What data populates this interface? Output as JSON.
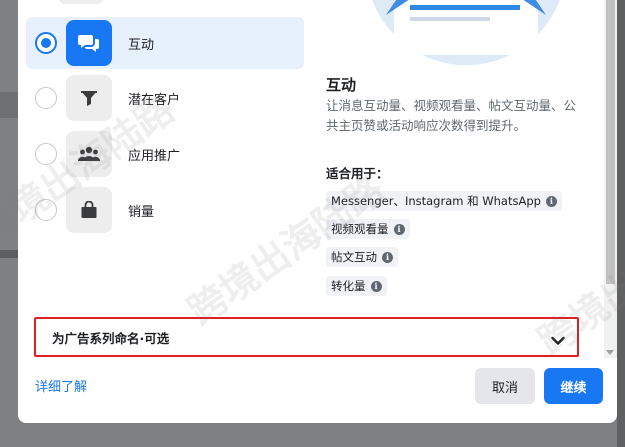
{
  "objectives": [
    {
      "label": "互动",
      "icon": "chat-bubbles-icon",
      "selected": true
    },
    {
      "label": "潜在客户",
      "icon": "funnel-icon",
      "selected": false
    },
    {
      "label": "应用推广",
      "icon": "people-icon",
      "selected": false
    },
    {
      "label": "销量",
      "icon": "shopping-bag-icon",
      "selected": false
    }
  ],
  "detail": {
    "title": "互动",
    "description": "让消息互动量、视频观看量、帖文互动量、公共主页赞或活动响应次数得到提升。",
    "fit_label": "适合用于：",
    "chips": [
      "Messenger、Instagram 和 WhatsApp",
      "视频观看量",
      "帖文互动",
      "转化量"
    ]
  },
  "campaign_name": {
    "label": "为广告系列命名·可选"
  },
  "footer": {
    "learn_more": "详细了解",
    "cancel": "取消",
    "continue": "继续"
  },
  "watermark": "跨境出海陆路",
  "colors": {
    "accent": "#1877f2",
    "selected_bg": "#e7f0fd",
    "highlight_border": "#e02020"
  }
}
